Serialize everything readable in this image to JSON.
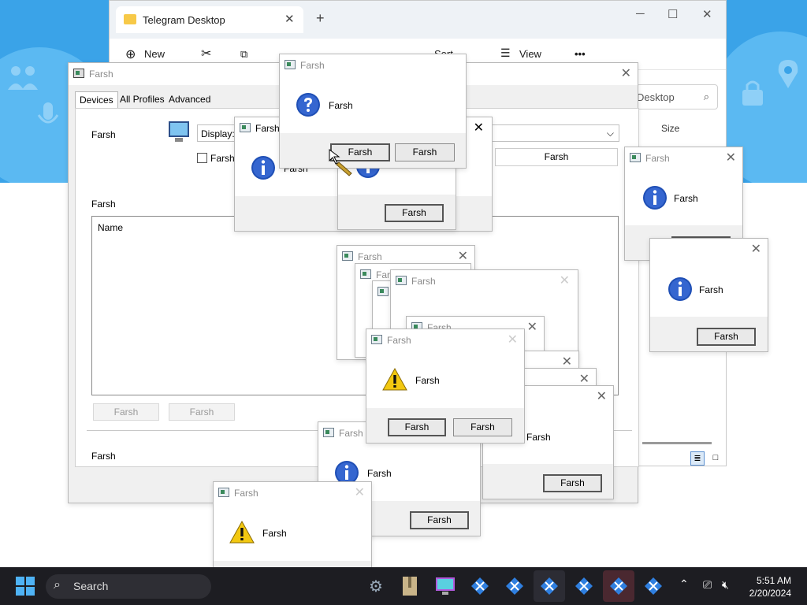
{
  "explorer": {
    "tab_title": "Telegram Desktop",
    "new_label": "New",
    "sort_label": "Sort",
    "view_label": "View",
    "more_label": "•••",
    "search_placeholder": "Desktop",
    "col_size": "Size"
  },
  "device_dialog": {
    "title": "Farsh",
    "tabs": [
      "Devices",
      "All Profiles",
      "Advanced"
    ],
    "device_label": "Farsh",
    "display_label": "Display:",
    "checkbox_label": "Farsh",
    "profiles_label": "Farsh",
    "list_header": "Name",
    "add_button": "Farsh",
    "remove_button": "Farsh",
    "bottom_label": "Farsh",
    "right_button": "Farsh"
  },
  "msg": {
    "title": "Farsh",
    "text": "Farsh",
    "button": "Farsh"
  },
  "taskbar": {
    "search_placeholder": "Search",
    "time": "5:51 AM",
    "date": "2/20/2024"
  },
  "colors": {
    "accent": "#3aa3e8",
    "info_blue": "#1f4fb5",
    "warning_yellow": "#f2c811"
  }
}
